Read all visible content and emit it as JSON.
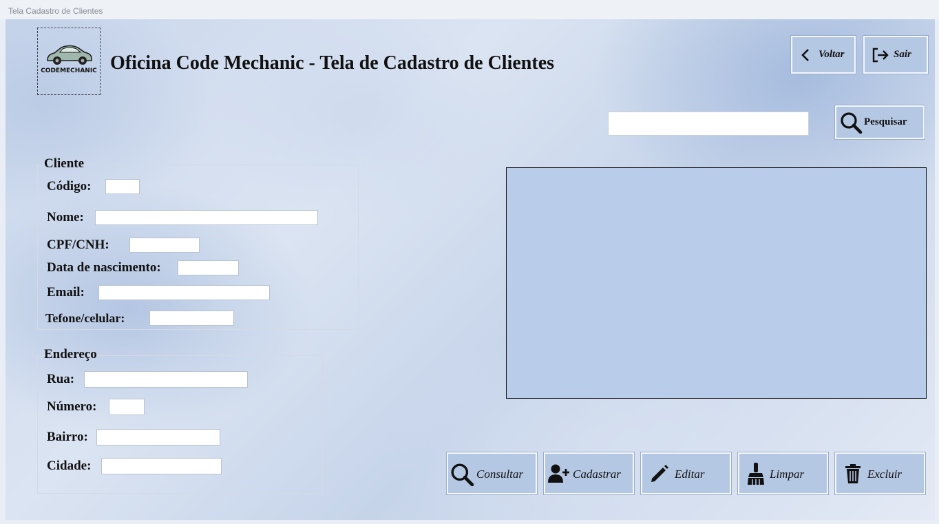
{
  "window": {
    "title": "Tela Cadastro de Clientes"
  },
  "header": {
    "logo_text": "CODEMECHANIC",
    "title": "Oficina Code Mechanic - Tela de Cadastro de Clientes",
    "voltar_label": "Voltar",
    "sair_label": "Sair"
  },
  "search": {
    "value": "",
    "button_label": "Pesquisar"
  },
  "cliente": {
    "legend": "Cliente",
    "codigo_label": "Código:",
    "nome_label": "Nome:",
    "cpf_label": "CPF/CNH:",
    "nascimento_label": "Data de nascimento:",
    "email_label": "Email:",
    "telefone_label": "Tefone/celular:",
    "codigo": "",
    "nome": "",
    "cpf": "",
    "nascimento": "",
    "email": "",
    "telefone": ""
  },
  "endereco": {
    "legend": "Endereço",
    "rua_label": "Rua:",
    "numero_label": "Número:",
    "bairro_label": "Bairro:",
    "cidade_label": "Cidade:",
    "rua": "",
    "numero": "",
    "bairro": "",
    "cidade": ""
  },
  "actions": {
    "consultar": "Consultar",
    "cadastrar": "Cadastrar",
    "editar": "Editar",
    "limpar": "Limpar",
    "excluir": "Excluir"
  },
  "icons": {
    "voltar": "chevron-left-icon",
    "sair": "sign-out-icon",
    "pesquisar": "search-icon",
    "consultar": "search-icon",
    "cadastrar": "user-plus-icon",
    "editar": "pencil-icon",
    "limpar": "broom-icon",
    "excluir": "trash-icon"
  },
  "colors": {
    "button_fill": "#b4c7e3",
    "grid_fill": "#b9cdea",
    "background": "#c9d6ec"
  }
}
